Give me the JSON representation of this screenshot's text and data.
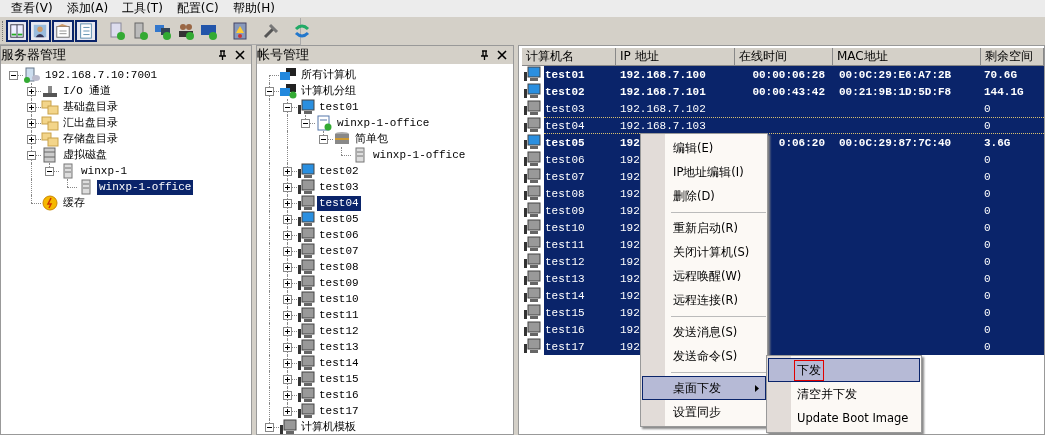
{
  "menu_bar": [
    "查看(V)",
    "添加(A)",
    "工具(T)",
    "配置(C)",
    "帮助(H)"
  ],
  "toolbar_groups": [
    [
      {
        "pressed": true
      },
      {
        "pressed": true
      },
      {
        "pressed": true
      },
      {
        "pressed": true
      }
    ],
    [
      {
        "pressed": false
      },
      {
        "pressed": false
      },
      {
        "pressed": false
      },
      {
        "pressed": false
      },
      {
        "pressed": false
      }
    ],
    [
      {
        "pressed": false
      }
    ],
    [
      {
        "pressed": false
      }
    ],
    [
      {
        "pressed": false
      }
    ]
  ],
  "panels": [
    {
      "title": "服务器管理",
      "tree": [
        {
          "label": "192.168.7.10:7001",
          "kind": "server",
          "expanded": true,
          "selected": false,
          "children": [
            {
              "label": "I/O 通道",
              "kind": "device",
              "expanded": false,
              "selected": false
            },
            {
              "label": "基础盘目录",
              "kind": "folder",
              "expanded": false,
              "selected": false
            },
            {
              "label": "汇出盘目录",
              "kind": "folder",
              "expanded": false,
              "selected": false
            },
            {
              "label": "存储盘目录",
              "kind": "folder",
              "expanded": false,
              "selected": false
            },
            {
              "label": "虚拟磁盘",
              "kind": "disks",
              "expanded": true,
              "selected": false,
              "children": [
                {
                  "label": "winxp-1",
                  "kind": "disk",
                  "expanded": true,
                  "selected": false,
                  "children": [
                    {
                      "label": "winxp-1-office",
                      "kind": "disk",
                      "selected": true
                    }
                  ]
                }
              ]
            },
            {
              "label": "缓存",
              "kind": "cache",
              "selected": false
            }
          ]
        }
      ]
    },
    {
      "title": "帐号管理",
      "tree": [
        {
          "label": "所有计算机",
          "kind": "network",
          "selected": false
        },
        {
          "label": "计算机分组",
          "kind": "group",
          "expanded": true,
          "selected": false,
          "children": [
            {
              "label": "test01",
              "kind": "computer",
              "online": true,
              "expanded": true,
              "selected": false,
              "children": [
                {
                  "label": "winxp-1-office",
                  "kind": "image",
                  "expanded": true,
                  "selected": false,
                  "children": [
                    {
                      "label": "简单包",
                      "kind": "package",
                      "expanded": true,
                      "selected": false,
                      "children": [
                        {
                          "label": "winxp-1-office",
                          "kind": "disk",
                          "selected": false
                        }
                      ]
                    }
                  ]
                }
              ]
            },
            {
              "label": "test02",
              "kind": "computer",
              "online": true,
              "expanded": false,
              "selected": false
            },
            {
              "label": "test03",
              "kind": "computer",
              "online": false,
              "expanded": false,
              "selected": false
            },
            {
              "label": "test04",
              "kind": "computer",
              "online": false,
              "expanded": false,
              "selected": true
            },
            {
              "label": "test05",
              "kind": "computer",
              "online": true,
              "expanded": false,
              "selected": false
            },
            {
              "label": "test06",
              "kind": "computer",
              "online": false,
              "expanded": false,
              "selected": false
            },
            {
              "label": "test07",
              "kind": "computer",
              "online": false,
              "expanded": false,
              "selected": false
            },
            {
              "label": "test08",
              "kind": "computer",
              "online": false,
              "expanded": false,
              "selected": false
            },
            {
              "label": "test09",
              "kind": "computer",
              "online": false,
              "expanded": false,
              "selected": false
            },
            {
              "label": "test10",
              "kind": "computer",
              "online": false,
              "expanded": false,
              "selected": false
            },
            {
              "label": "test11",
              "kind": "computer",
              "online": false,
              "expanded": false,
              "selected": false
            },
            {
              "label": "test12",
              "kind": "computer",
              "online": false,
              "expanded": false,
              "selected": false
            },
            {
              "label": "test13",
              "kind": "computer",
              "online": false,
              "expanded": false,
              "selected": false
            },
            {
              "label": "test14",
              "kind": "computer",
              "online": false,
              "expanded": false,
              "selected": false
            },
            {
              "label": "test15",
              "kind": "computer",
              "online": false,
              "expanded": false,
              "selected": false
            },
            {
              "label": "test16",
              "kind": "computer",
              "online": false,
              "expanded": false,
              "selected": false
            },
            {
              "label": "test17",
              "kind": "computer",
              "online": false,
              "expanded": false,
              "selected": false
            }
          ]
        },
        {
          "label": "计算机模板",
          "kind": "computer",
          "online": false,
          "expanded": true,
          "selected": false
        }
      ]
    }
  ],
  "table": {
    "columns": [
      "计算机名",
      "IP 地址",
      "在线时间",
      "MAC地址",
      "剩余空间"
    ],
    "rows": [
      {
        "name": "test01",
        "ip": "192.168.7.100",
        "online_time": "00:00:06:28",
        "mac": "00:0C:29:E6:A7:2B",
        "free": "70.6G",
        "online": true,
        "selected": true,
        "focused": false
      },
      {
        "name": "test02",
        "ip": "192.168.7.101",
        "online_time": "00:00:43:42",
        "mac": "00:21:9B:1D:5D:F8",
        "free": "144.1G",
        "online": true,
        "selected": true,
        "focused": false
      },
      {
        "name": "test03",
        "ip": "192.168.7.102",
        "free": "0",
        "online": false,
        "selected": true,
        "focused": false
      },
      {
        "name": "test04",
        "ip": "192.168.7.103",
        "free": "0",
        "online": false,
        "selected": true,
        "focused": true
      },
      {
        "name": "test05",
        "ip": "192",
        "online_time": "0:06:20",
        "mac": "00:0C:29:87:7C:40",
        "free": "3.6G",
        "online": true,
        "selected": true,
        "focused": false
      },
      {
        "name": "test06",
        "ip": "192",
        "free": "0",
        "online": false,
        "selected": true,
        "focused": false
      },
      {
        "name": "test07",
        "ip": "192",
        "free": "0",
        "online": false,
        "selected": true,
        "focused": false
      },
      {
        "name": "test08",
        "ip": "192",
        "free": "0",
        "online": false,
        "selected": true,
        "focused": false
      },
      {
        "name": "test09",
        "ip": "192",
        "free": "0",
        "online": false,
        "selected": true,
        "focused": false
      },
      {
        "name": "test10",
        "ip": "192",
        "free": "0",
        "online": false,
        "selected": true,
        "focused": false
      },
      {
        "name": "test11",
        "ip": "192",
        "free": "0",
        "online": false,
        "selected": true,
        "focused": false
      },
      {
        "name": "test12",
        "ip": "192",
        "free": "0",
        "online": false,
        "selected": true,
        "focused": false
      },
      {
        "name": "test13",
        "ip": "192",
        "free": "0",
        "online": false,
        "selected": true,
        "focused": false
      },
      {
        "name": "test14",
        "ip": "192",
        "free": "0",
        "online": false,
        "selected": true,
        "focused": false
      },
      {
        "name": "test15",
        "ip": "192",
        "free": "0",
        "online": false,
        "selected": true,
        "focused": false
      },
      {
        "name": "test16",
        "ip": "192",
        "free": "0",
        "online": false,
        "selected": true,
        "focused": false
      },
      {
        "name": "test17",
        "ip": "192",
        "free": "0",
        "online": false,
        "selected": true,
        "focused": false
      }
    ]
  },
  "context_menu": {
    "items": [
      {
        "kind": "item",
        "label": "编辑(E)",
        "highlighted": false
      },
      {
        "kind": "item",
        "label": "IP地址编辑(I)",
        "highlighted": false
      },
      {
        "kind": "item",
        "label": "删除(D)",
        "highlighted": false
      },
      {
        "kind": "separator"
      },
      {
        "kind": "item",
        "label": "重新启动(R)",
        "highlighted": false
      },
      {
        "kind": "item",
        "label": "关闭计算机(S)",
        "highlighted": false
      },
      {
        "kind": "item",
        "label": "远程唤醒(W)",
        "highlighted": false
      },
      {
        "kind": "item",
        "label": "远程连接(R)",
        "highlighted": false
      },
      {
        "kind": "separator"
      },
      {
        "kind": "item",
        "label": "发送消息(S)",
        "highlighted": false
      },
      {
        "kind": "item",
        "label": "发送命令(S)",
        "highlighted": false
      },
      {
        "kind": "separator"
      },
      {
        "kind": "submenu",
        "label": "桌面下发",
        "highlighted": true
      },
      {
        "kind": "item",
        "label": "设置同步",
        "highlighted": false
      }
    ]
  },
  "submenu": {
    "items": [
      {
        "label": "下发",
        "highlighted": true,
        "focused": true
      },
      {
        "label": "清空并下发",
        "highlighted": false,
        "focused": false
      },
      {
        "label": "Update Boot Image",
        "highlighted": false,
        "focused": false
      }
    ]
  }
}
